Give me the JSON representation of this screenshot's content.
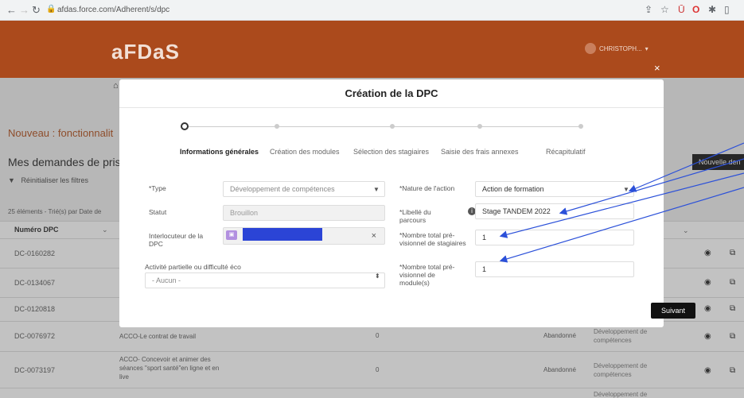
{
  "browser": {
    "url": "afdas.force.com/Adherent/s/dpc"
  },
  "header": {
    "logo": "aFDaS",
    "user_name": "CHRISTOPH...",
    "close": "×"
  },
  "background": {
    "new_title": "Nouveau : fonctionnalit",
    "list_title": "Mes demandes de prise",
    "reset_filters": "Réinitialiser les filtres",
    "count_label": "25 éléments - Trié(s) par Date de",
    "col_numero": "Numéro DPC",
    "new_button": "Nouvelle den",
    "rows": [
      {
        "num": "DC-0160282",
        "title": "",
        "zero": "",
        "status": "",
        "type": ""
      },
      {
        "num": "DC-0134067",
        "title": "",
        "zero": "",
        "status": "",
        "type": ""
      },
      {
        "num": "DC-0120818",
        "title": "",
        "zero": "",
        "status": "",
        "type": ""
      },
      {
        "num": "DC-0076972",
        "title": "ACCO-Le contrat de travail",
        "zero": "0",
        "status": "Abandonné",
        "type": "Développement de compétences"
      },
      {
        "num": "DC-0073197",
        "title": "ACCO- Concevoir et animer des séances \"sport santé\"en ligne et en live",
        "zero": "0",
        "status": "Abandonné",
        "type": "Développement de compétences"
      },
      {
        "num": "",
        "title": "",
        "zero": "",
        "status": "",
        "type": "Développement de"
      }
    ]
  },
  "modal": {
    "title": "Création de la DPC",
    "steps": [
      {
        "label": "Informations générales",
        "active": true
      },
      {
        "label": "Création des modules",
        "active": false
      },
      {
        "label": "Sélection des stagiaires",
        "active": false
      },
      {
        "label": "Saisie des frais annexes",
        "active": false
      },
      {
        "label": "Récapitulatif",
        "active": false
      }
    ],
    "fields": {
      "type_label": "*Type",
      "type_value": "Développement de compétences",
      "statut_label": "Statut",
      "statut_value": "Brouillon",
      "interlocuteur_label": "Interlocuteur de la DPC",
      "interlocuteur_value": "C",
      "activite_label": "Activité partielle ou difficulté éco",
      "activite_value": "- Aucun -",
      "nature_label": "*Nature de l'action",
      "nature_value": "Action de formation",
      "libelle_label": "*Libellé du parcours",
      "libelle_value": "Stage TANDEM 2022",
      "nb_stagiaires_label": "*Nombre total pré-visionnel de stagiaires",
      "nb_stagiaires_value": "1",
      "nb_modules_label": "*Nombre total pré-visionnel de module(s)",
      "nb_modules_value": "1"
    },
    "next_button": "Suivant"
  },
  "colors": {
    "header_bg": "#ab4a1c",
    "accent_orange": "#b04c18",
    "arrow_blue": "#2b50d9"
  }
}
